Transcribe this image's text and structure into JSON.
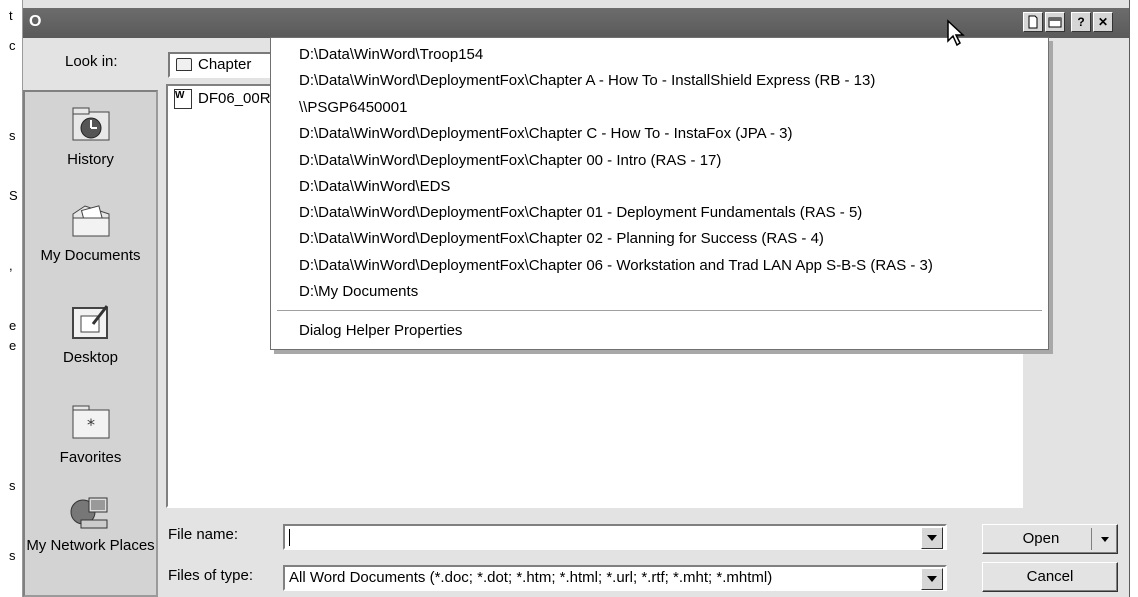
{
  "window": {
    "title": "O"
  },
  "title_buttons": [
    {
      "name": "new-page-icon",
      "glyph": "▢"
    },
    {
      "name": "folder-icon",
      "glyph": "▭"
    },
    {
      "name": "help-icon",
      "glyph": "?"
    },
    {
      "name": "close-icon",
      "glyph": "✕"
    }
  ],
  "lookin": {
    "label": "Look in:",
    "value": "Chapter"
  },
  "places": [
    {
      "id": "history",
      "label": "History",
      "icon": "history-icon"
    },
    {
      "id": "my-documents",
      "label": "My Documents",
      "icon": "my-documents-icon"
    },
    {
      "id": "desktop",
      "label": "Desktop",
      "icon": "desktop-icon"
    },
    {
      "id": "favorites",
      "label": "Favorites",
      "icon": "favorites-icon"
    },
    {
      "id": "my-network-places",
      "label": "My Network Places",
      "icon": "network-icon"
    }
  ],
  "files": [
    {
      "name": "DF06_00R",
      "icon": "word-document-icon"
    }
  ],
  "filename": {
    "label": "File name:",
    "value": ""
  },
  "filetype": {
    "label": "Files of type:",
    "value": "All Word Documents (*.doc; *.dot; *.htm; *.html; *.url; *.rtf; *.mht; *.mhtml)"
  },
  "buttons": {
    "open": "Open",
    "cancel": "Cancel"
  },
  "recent_menu": {
    "items": [
      "D:\\Data\\WinWord\\Troop154",
      "D:\\Data\\WinWord\\DeploymentFox\\Chapter A - How To - InstallShield Express  (RB - 13)",
      "\\\\PSGP6450001",
      "D:\\Data\\WinWord\\DeploymentFox\\Chapter C - How To - InstaFox (JPA - 3)",
      "D:\\Data\\WinWord\\DeploymentFox\\Chapter 00 - Intro (RAS - 17)",
      "D:\\Data\\WinWord\\EDS",
      "D:\\Data\\WinWord\\DeploymentFox\\Chapter 01 - Deployment Fundamentals (RAS - 5)",
      "D:\\Data\\WinWord\\DeploymentFox\\Chapter 02 - Planning for Success (RAS - 4)",
      "D:\\Data\\WinWord\\DeploymentFox\\Chapter 06 - Workstation and Trad LAN App S-B-S  (RAS - 3)",
      "D:\\My Documents"
    ],
    "footer": "Dialog Helper Properties"
  },
  "stray_chars": [
    "t",
    "c",
    "s",
    "S",
    ",",
    "e",
    "e",
    "s",
    "s"
  ]
}
